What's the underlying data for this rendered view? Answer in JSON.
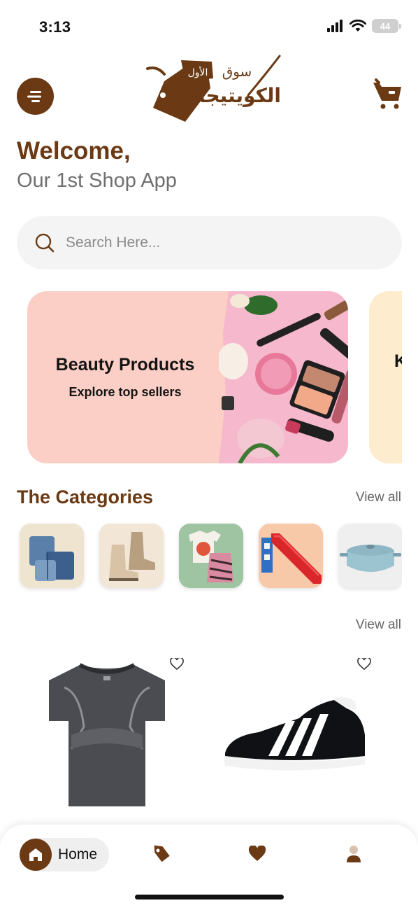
{
  "status_bar": {
    "time": "3:13",
    "battery": "44",
    "icons": [
      "cellular-signal-icon",
      "wifi-icon",
      "battery-icon"
    ]
  },
  "header": {
    "logo_text_top": "سوق",
    "logo_text_badge": "الأول",
    "logo_text_main": "الكويتيجا",
    "icons": [
      "menu-icon",
      "cart-icon"
    ]
  },
  "welcome": {
    "title": "Welcome,",
    "subtitle": "Our 1st Shop App"
  },
  "search": {
    "placeholder": "Search Here...",
    "value": "",
    "icon": "search-icon"
  },
  "banners": [
    {
      "title": "Beauty Products",
      "subtitle": "Explore top sellers",
      "image": "cosmetics-image"
    },
    {
      "title": "K",
      "subtitle": "",
      "image": ""
    }
  ],
  "categories_section": {
    "title": "The Categories",
    "view_all": "View all",
    "items": [
      {
        "image": "jeans-image"
      },
      {
        "image": "boots-image"
      },
      {
        "image": "tops-image"
      },
      {
        "image": "slide-toy-image"
      },
      {
        "image": "cookware-pot-image"
      }
    ]
  },
  "products_section": {
    "view_all": "View all",
    "items": [
      {
        "image": "tshirt-image",
        "icon": "heart-outline-icon"
      },
      {
        "image": "sneaker-image",
        "icon": "heart-outline-icon"
      }
    ]
  },
  "bottom_nav": {
    "home_label": "Home",
    "icons": [
      "home-icon",
      "tag-icon",
      "heart-icon",
      "user-icon"
    ]
  },
  "colors": {
    "brand": "#6b3a14",
    "banner_bg": "#fbcfc5",
    "banner_next_bg": "#fdeccd",
    "search_bg": "#f4f4f4"
  }
}
